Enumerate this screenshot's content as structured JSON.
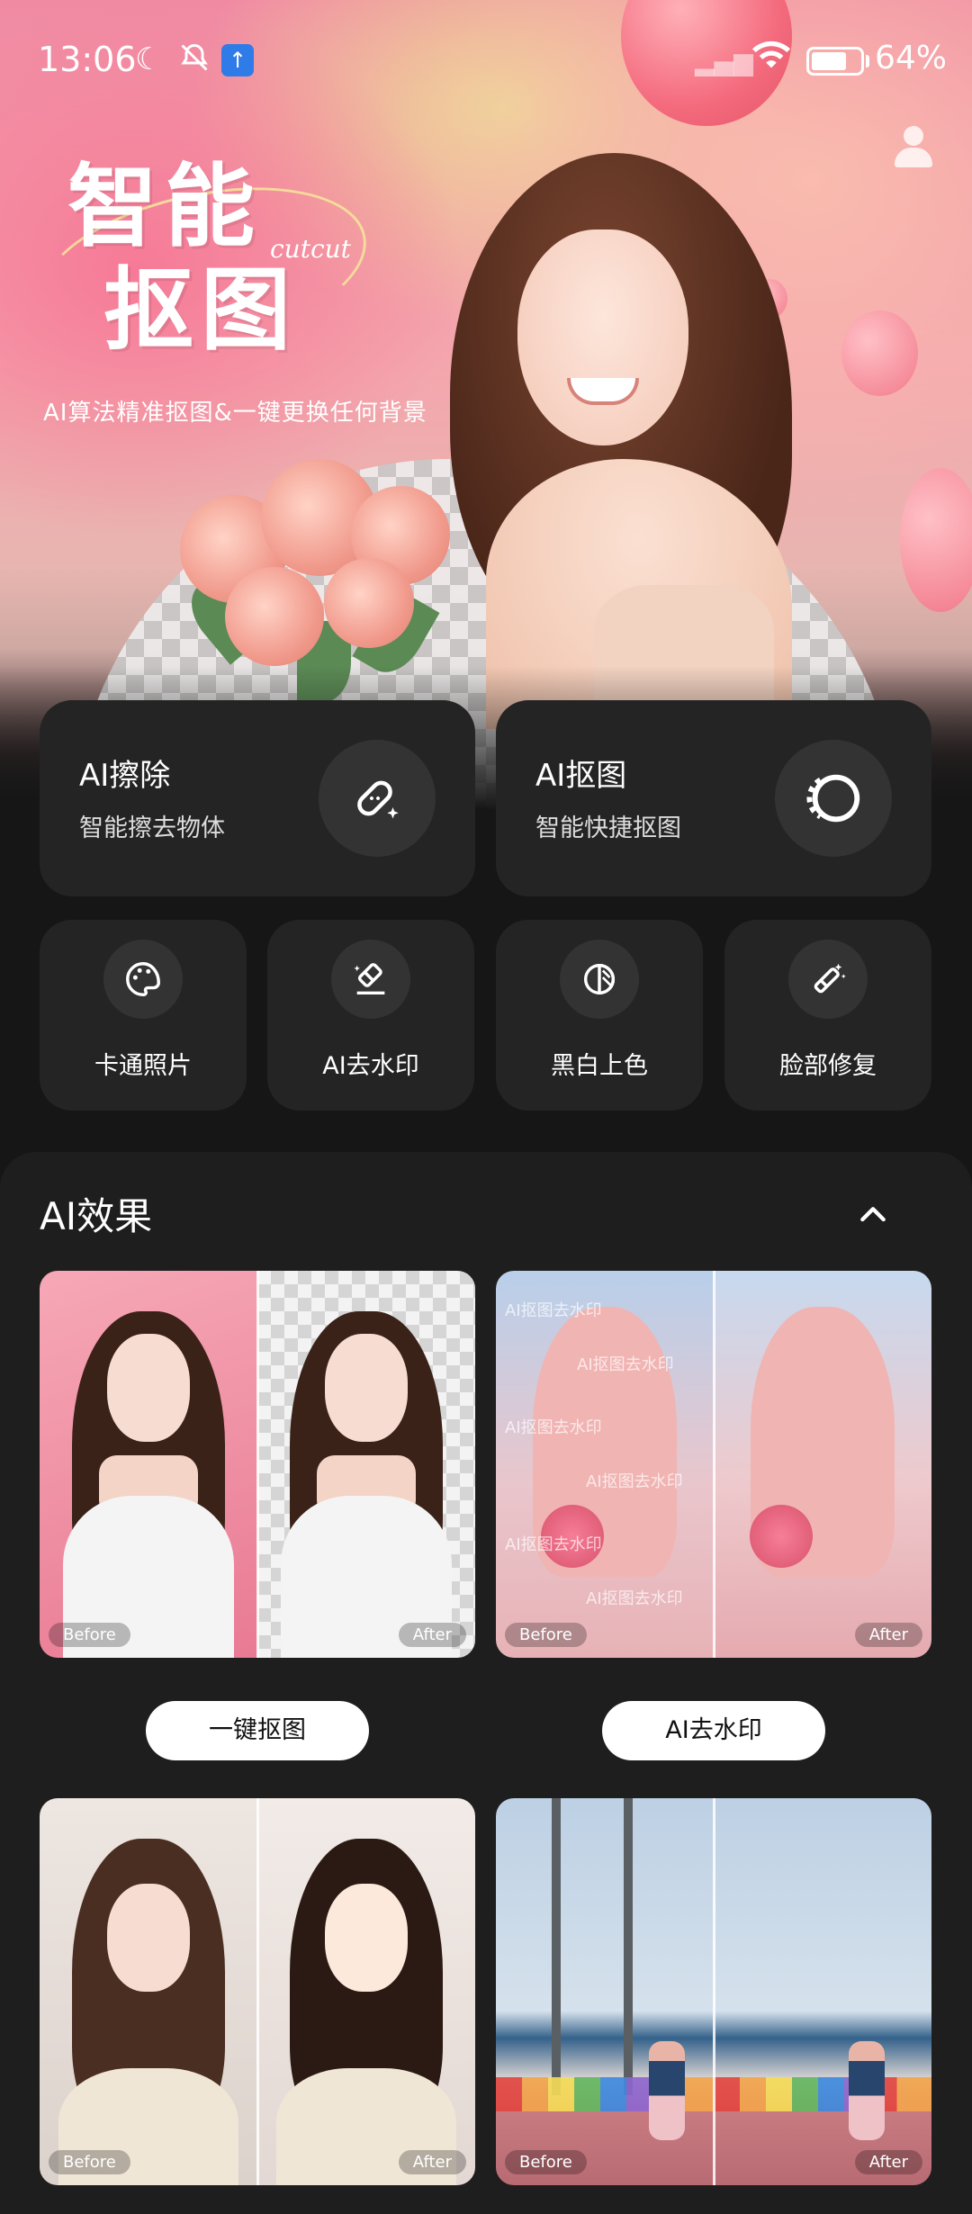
{
  "status_bar": {
    "time": "13:06",
    "battery_percent": "64%"
  },
  "hero": {
    "title_line1": "智能",
    "title_line2": "抠图",
    "title_script": "cutcut",
    "subtitle": "AI算法精准抠图&一键更换任何背景"
  },
  "features_large": [
    {
      "title": "AI擦除",
      "subtitle": "智能擦去物体",
      "icon": "bandage-sparkle-icon"
    },
    {
      "title": "AI抠图",
      "subtitle": "智能快捷抠图",
      "icon": "cutout-ring-icon"
    }
  ],
  "features_small": [
    {
      "label": "卡通照片",
      "icon": "palette-icon"
    },
    {
      "label": "AI去水印",
      "icon": "eraser-icon"
    },
    {
      "label": "黑白上色",
      "icon": "half-circle-icon"
    },
    {
      "label": "脸部修复",
      "icon": "magic-wand-icon"
    }
  ],
  "effects_section": {
    "title": "AI效果",
    "before_label": "Before",
    "after_label": "After",
    "watermark_text": "AI抠图去水印",
    "buttons": [
      "一键抠图",
      "AI去水印"
    ]
  },
  "colors": {
    "background": "#161616",
    "card": "#242424",
    "panel": "#1e1e1e",
    "accent_blue": "#2f7ce8"
  }
}
